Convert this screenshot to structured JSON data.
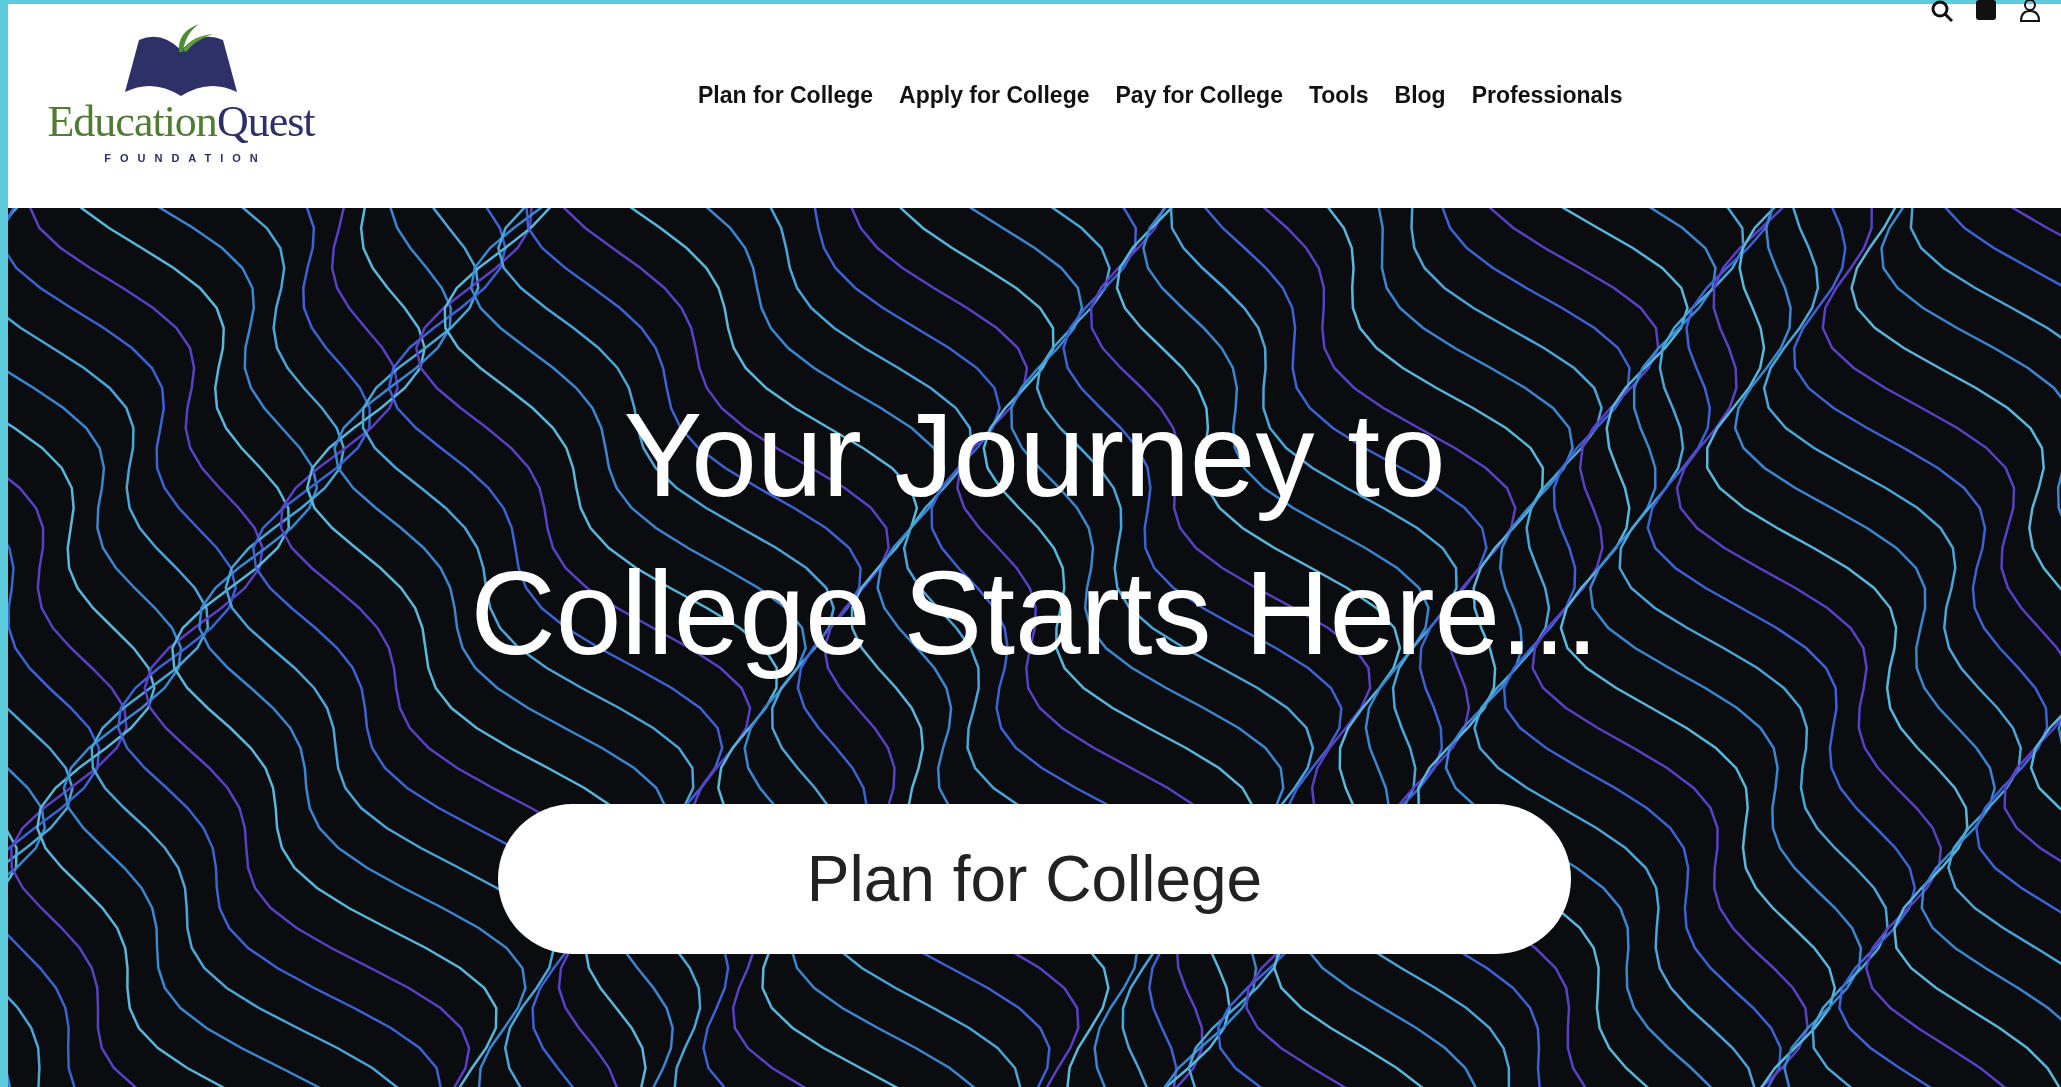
{
  "logo": {
    "name_first": "Education",
    "name_second": "Quest",
    "tagline": "FOUNDATION"
  },
  "nav": [
    {
      "label": "Plan for College"
    },
    {
      "label": "Apply for College"
    },
    {
      "label": "Pay for College"
    },
    {
      "label": "Tools"
    },
    {
      "label": "Blog"
    },
    {
      "label": "Professionals"
    }
  ],
  "utility_icons": [
    {
      "kind": "search"
    },
    {
      "kind": "block"
    },
    {
      "kind": "user"
    }
  ],
  "hero": {
    "headline_lines": [
      "Your Journey to",
      "College Starts Here..."
    ],
    "button": "Plan for College"
  }
}
